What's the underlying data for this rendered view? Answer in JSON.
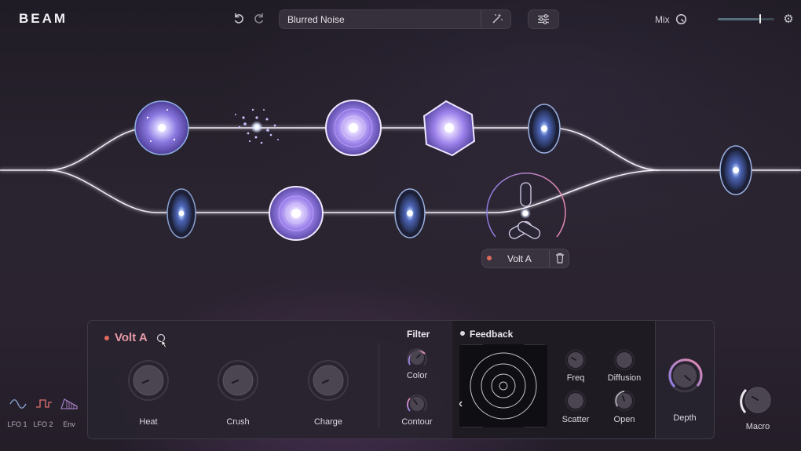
{
  "app": {
    "logo": "BEAM"
  },
  "header": {
    "undo_icon": "undo-icon",
    "redo_icon": "redo-icon",
    "preset_name": "Blurred Noise",
    "randomize_icon": "magic-wand-icon",
    "settings_sliders_icon": "sliders-icon",
    "mix_label": "Mix",
    "mix_value": 0.72,
    "gear_icon": "gear-icon"
  },
  "graph": {
    "nodes": [
      "orb-sphere",
      "particle-cloud",
      "glass-sphere",
      "crystal-hex",
      "lens-disc",
      "lens-disc",
      "glass-sphere",
      "lens-disc",
      "volt-tri-node",
      "output-lens"
    ],
    "selected_node": {
      "label": "Volt A",
      "status_color": "#e06a5a",
      "delete_icon": "trash-icon"
    }
  },
  "panel": {
    "module_title": "Volt A",
    "module_dot_color": "#e06a5a",
    "macro_knobs": [
      {
        "label": "Heat",
        "value": 0.55
      },
      {
        "label": "Crush",
        "value": 0.55
      },
      {
        "label": "Charge",
        "value": 0.55
      }
    ],
    "filter": {
      "title": "Filter",
      "knobs": [
        {
          "label": "Color",
          "value": 0.6
        },
        {
          "label": "Contour",
          "value": 0.35
        }
      ]
    },
    "feedback": {
      "title": "Feedback",
      "knobs": [
        {
          "label": "Freq",
          "value": 0.3
        },
        {
          "label": "Diffusion",
          "value": 0.5
        },
        {
          "label": "Scatter",
          "value": 0.5
        },
        {
          "label": "Open",
          "value": 0.6
        }
      ]
    },
    "depth": {
      "label": "Depth",
      "value": 0.7
    }
  },
  "modulators": [
    {
      "label": "LFO 1",
      "icon": "sine-wave-icon",
      "color": "#8fa6d8"
    },
    {
      "label": "LFO 2",
      "icon": "square-wave-icon",
      "color": "#e07070"
    },
    {
      "label": "Env",
      "icon": "envelope-icon",
      "color": "#b48ad8"
    }
  ],
  "macro": {
    "label": "Macro",
    "value": 0.35
  },
  "colors": {
    "accent_pink": "#e79aa8",
    "accent_purple": "#a68df0",
    "panel_bg": "#28242e"
  }
}
